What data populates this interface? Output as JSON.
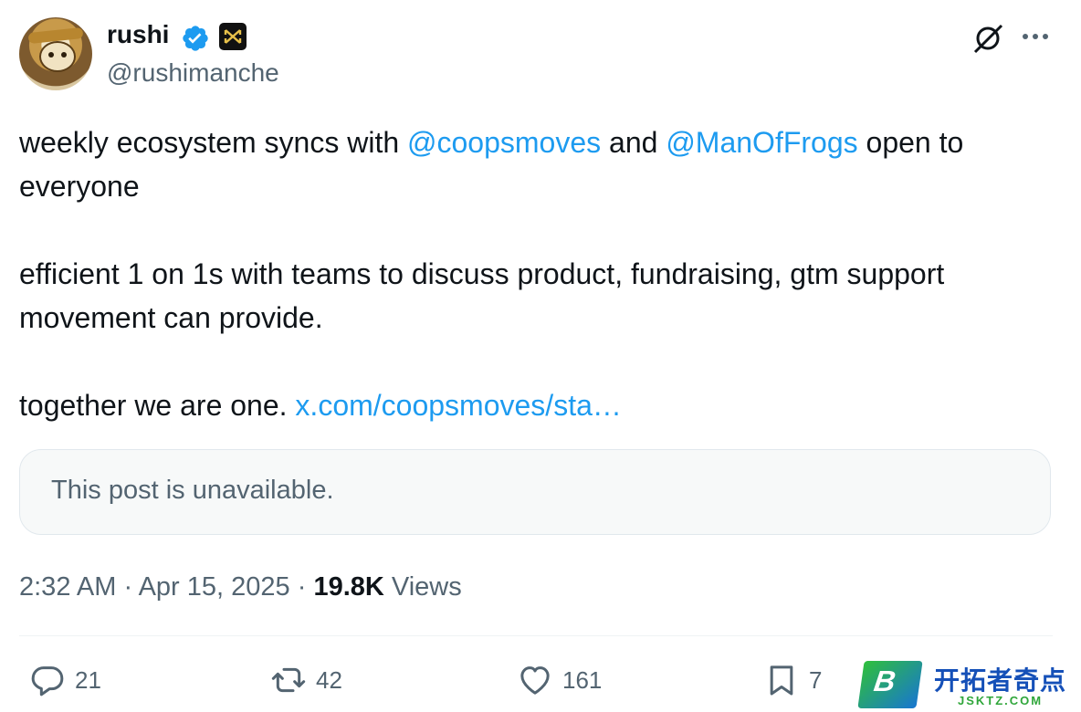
{
  "author": {
    "display_name": "rushi",
    "handle": "@rushimanche"
  },
  "tweet": {
    "line1_before": "weekly ecosystem syncs with ",
    "mention1": "@coopsmoves",
    "line1_middle": " and ",
    "mention2": "@ManOfFrogs",
    "line1_after": " open to everyone",
    "paragraph2": "efficient 1 on 1s with teams to discuss product, fundraising, gtm support movement can provide.",
    "paragraph3_text": "together we are one. ",
    "paragraph3_link": "x.com/coopsmoves/sta…"
  },
  "quote": {
    "text": "This post is unavailable."
  },
  "meta": {
    "time": "2:32 AM",
    "sep1": " · ",
    "date": "Apr 15, 2025",
    "sep2": " · ",
    "views_count": "19.8K",
    "views_label": " Views"
  },
  "actions": {
    "replies": "21",
    "reposts": "42",
    "likes": "161",
    "bookmarks": "7"
  },
  "watermark": {
    "title": "开拓者奇点",
    "url": "JSKTZ.COM",
    "logo_letter": "B"
  },
  "colors": {
    "link": "#1d9bf0",
    "secondary_text": "#536471",
    "verified": "#1d9bf0"
  },
  "icons": [
    "verified-icon",
    "affiliate-badge-icon",
    "grok-icon",
    "more-icon",
    "reply-icon",
    "retweet-icon",
    "like-icon",
    "bookmark-icon"
  ]
}
